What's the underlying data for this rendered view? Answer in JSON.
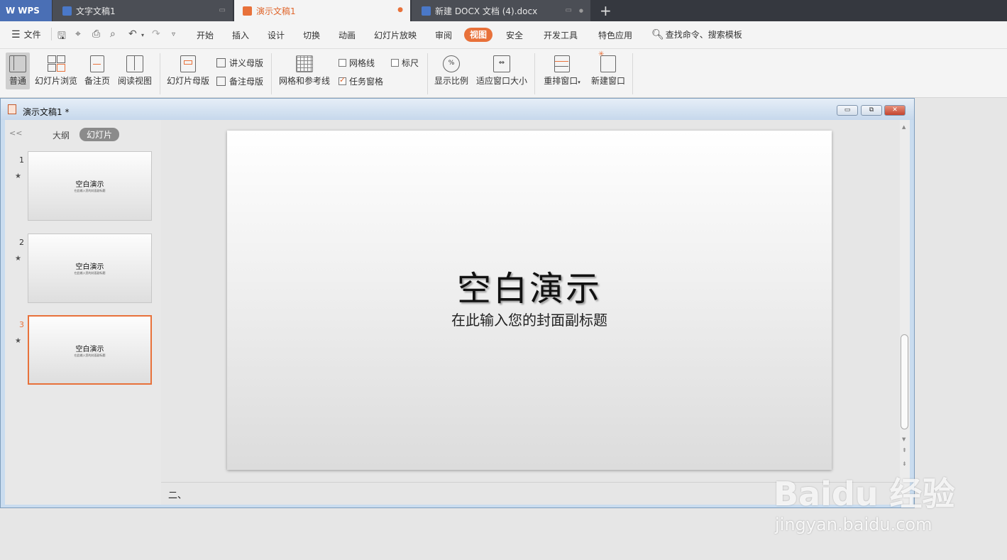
{
  "tabs": {
    "wps": "WPS",
    "doc1": "文字文稿1",
    "doc2": "演示文稿1",
    "doc3": "新建 DOCX 文档 (4).docx",
    "add": "+"
  },
  "menu": {
    "file": "文件",
    "items": [
      "开始",
      "插入",
      "设计",
      "切换",
      "动画",
      "幻灯片放映",
      "审阅",
      "视图",
      "安全",
      "开发工具",
      "特色应用"
    ],
    "active": "视图",
    "search": "查找命令、搜索模板"
  },
  "ribbon": {
    "normal": "普通",
    "browse": "幻灯片浏览",
    "notes_page": "备注页",
    "reading": "阅读视图",
    "slide_master": "幻灯片母版",
    "handout_master": "讲义母版",
    "notes_master": "备注母版",
    "grid_guides": "网格和参考线",
    "gridlines": "网格线",
    "ruler": "标尺",
    "task_pane": "任务窗格",
    "zoom": "显示比例",
    "fit_window": "适应窗口大小",
    "rearrange": "重排窗口",
    "new_window": "新建窗口"
  },
  "window": {
    "title": "演示文稿1 *",
    "min": "▭",
    "restore": "⧉",
    "close": "✕"
  },
  "panel": {
    "outline": "大纲",
    "slides": "幻灯片",
    "collapse": "<<"
  },
  "thumbs": [
    {
      "num": "1",
      "title": "空白演示",
      "sub": "在此输入您的封面副标题"
    },
    {
      "num": "2",
      "title": "空白演示",
      "sub": "在此输入您的封面副标题"
    },
    {
      "num": "3",
      "title": "空白演示",
      "sub": "在此输入您的封面副标题"
    }
  ],
  "slide": {
    "title": "空白演示",
    "subtitle": "在此输入您的封面副标题"
  },
  "notes": "二、",
  "watermark": {
    "brand": "Baidu 经验",
    "url": "jingyan.baidu.com"
  },
  "colors": {
    "accent": "#e8713a",
    "wps_blue": "#4a6fb5"
  }
}
